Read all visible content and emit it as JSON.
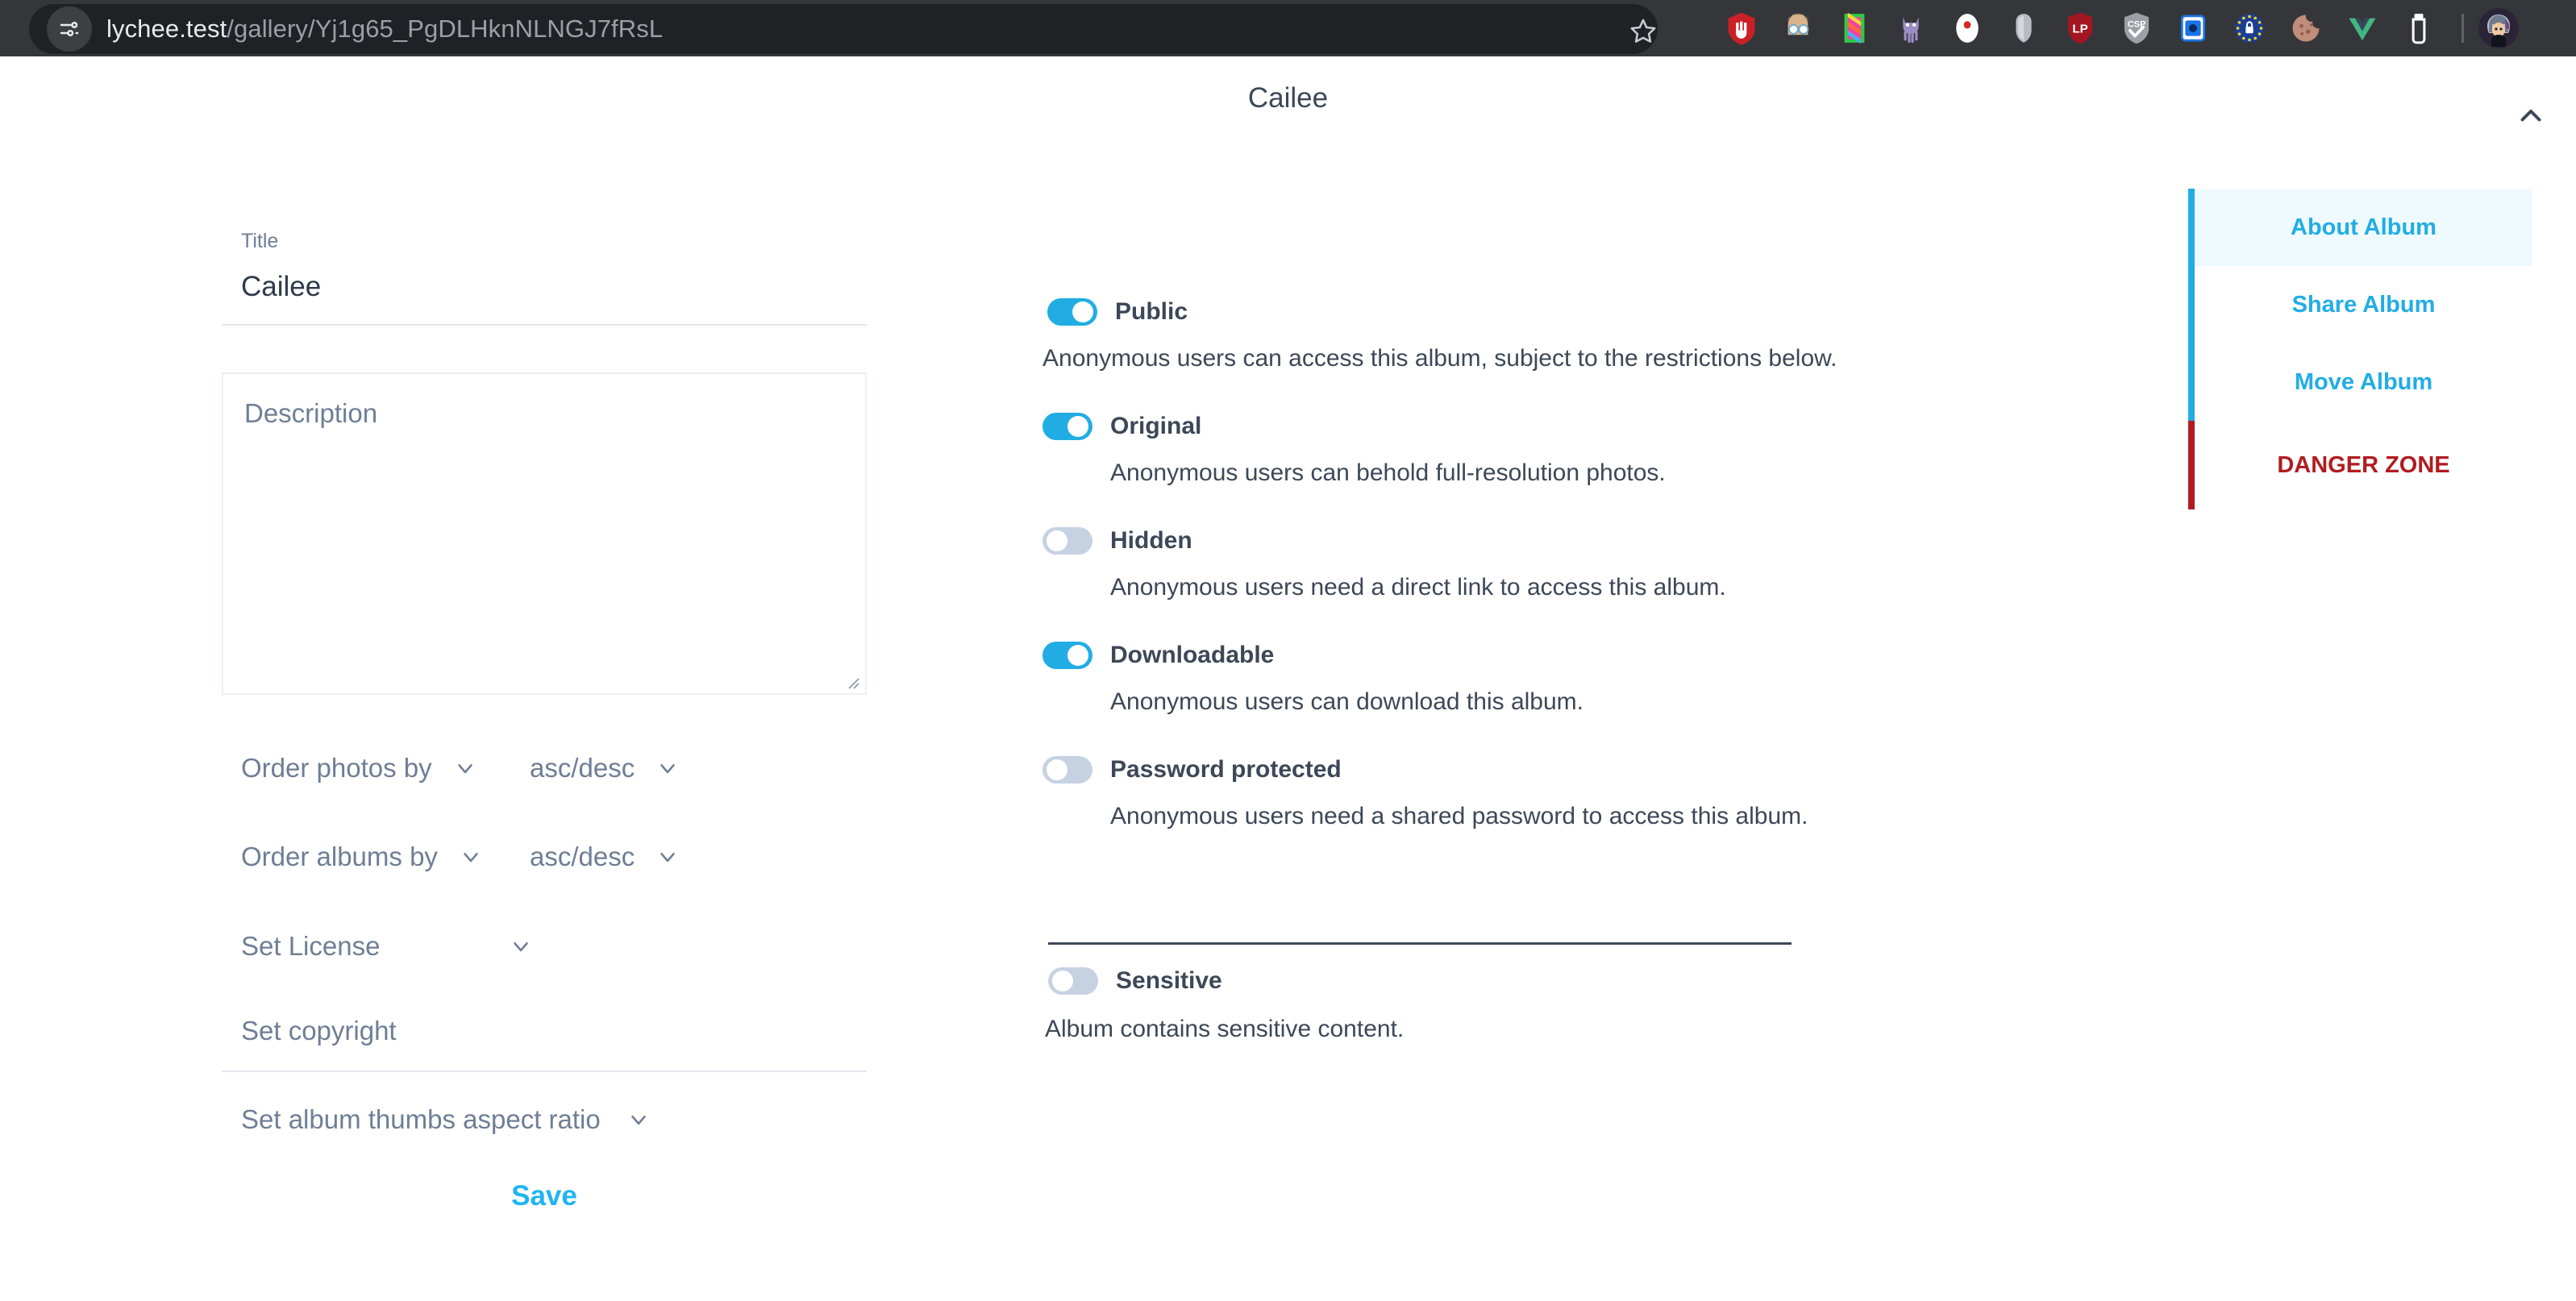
{
  "browser": {
    "url_host": "lychee.test",
    "url_path": "/gallery/Yj1g65_PgDLHknNLNGJ7fRsL",
    "site_info_icon": "site-settings-icon",
    "bookmark_icon": "star-icon",
    "extensions": [
      {
        "name": "ublock-origin-icon",
        "color": "#cb2027",
        "glyph": "✋"
      },
      {
        "name": "user-agent-switcher-icon",
        "color": "#d9b38c",
        "glyph": "ὅ3"
      },
      {
        "name": "colorzilla-icon",
        "color": "#2ecc40",
        "glyph": ""
      },
      {
        "name": "octotree-icon",
        "color": "#9b8ec4",
        "glyph": ""
      },
      {
        "name": "screen-recorder-icon",
        "color": "#ffffff",
        "glyph": ""
      },
      {
        "name": "tampermonkey-shield-icon",
        "color": "#b8bcc2",
        "glyph": ""
      },
      {
        "name": "lastpass-shield-icon",
        "color": "#a31621",
        "glyph": "LP"
      },
      {
        "name": "csp-evaluator-icon",
        "color": "#9aa0a6",
        "glyph": "CSP"
      },
      {
        "name": "json-viewer-icon",
        "color": "#1a73e8",
        "glyph": ""
      },
      {
        "name": "eu-cookie-blocker-icon",
        "color": "#1c3f94",
        "glyph": ""
      },
      {
        "name": "cookie-editor-icon",
        "color": "#c08d7a",
        "glyph": ""
      },
      {
        "name": "vue-devtools-icon",
        "color": "#41b883",
        "glyph": "V"
      },
      {
        "name": "clear-cache-icon",
        "color": "#ffffff",
        "glyph": ""
      }
    ],
    "profile_avatar": "user-avatar"
  },
  "header": {
    "title": "Cailee",
    "collapse_icon": "chevron-up-icon"
  },
  "form": {
    "title_label": "Title",
    "title_value": "Cailee",
    "description_placeholder": "Description",
    "order_photos": {
      "label": "Order photos by",
      "direction": "asc/desc"
    },
    "order_albums": {
      "label": "Order albums by",
      "direction": "asc/desc"
    },
    "license_label": "Set License",
    "copyright_placeholder": "Set copyright",
    "aspect_ratio_label": "Set album thumbs aspect ratio",
    "save_label": "Save"
  },
  "toggles": {
    "public": {
      "label": "Public",
      "description": "Anonymous users can access this album, subject to the restrictions below.",
      "state": "on"
    },
    "original": {
      "label": "Original",
      "description": "Anonymous users can behold full-resolution photos.",
      "state": "on"
    },
    "hidden": {
      "label": "Hidden",
      "description": "Anonymous users need a direct link to access this album.",
      "state": "off"
    },
    "downloadable": {
      "label": "Downloadable",
      "description": "Anonymous users can download this album.",
      "state": "on"
    },
    "password_protected": {
      "label": "Password protected",
      "description": "Anonymous users need a shared password to access this album.",
      "state": "off"
    },
    "sensitive": {
      "label": "Sensitive",
      "description": "Album contains sensitive content.",
      "state": "off"
    }
  },
  "sidebar": {
    "items": [
      {
        "label": "About Album",
        "active": true,
        "danger": false
      },
      {
        "label": "Share Album",
        "active": false,
        "danger": false
      },
      {
        "label": "Move Album",
        "active": false,
        "danger": false
      },
      {
        "label": "DANGER ZONE",
        "active": false,
        "danger": true
      }
    ]
  },
  "colors": {
    "accent": "#21ade4",
    "save": "#21b4f2",
    "danger": "#b01c20",
    "text": "#3d4757",
    "muted": "#6f7e95",
    "toggle_off": "#c6d2e2"
  }
}
